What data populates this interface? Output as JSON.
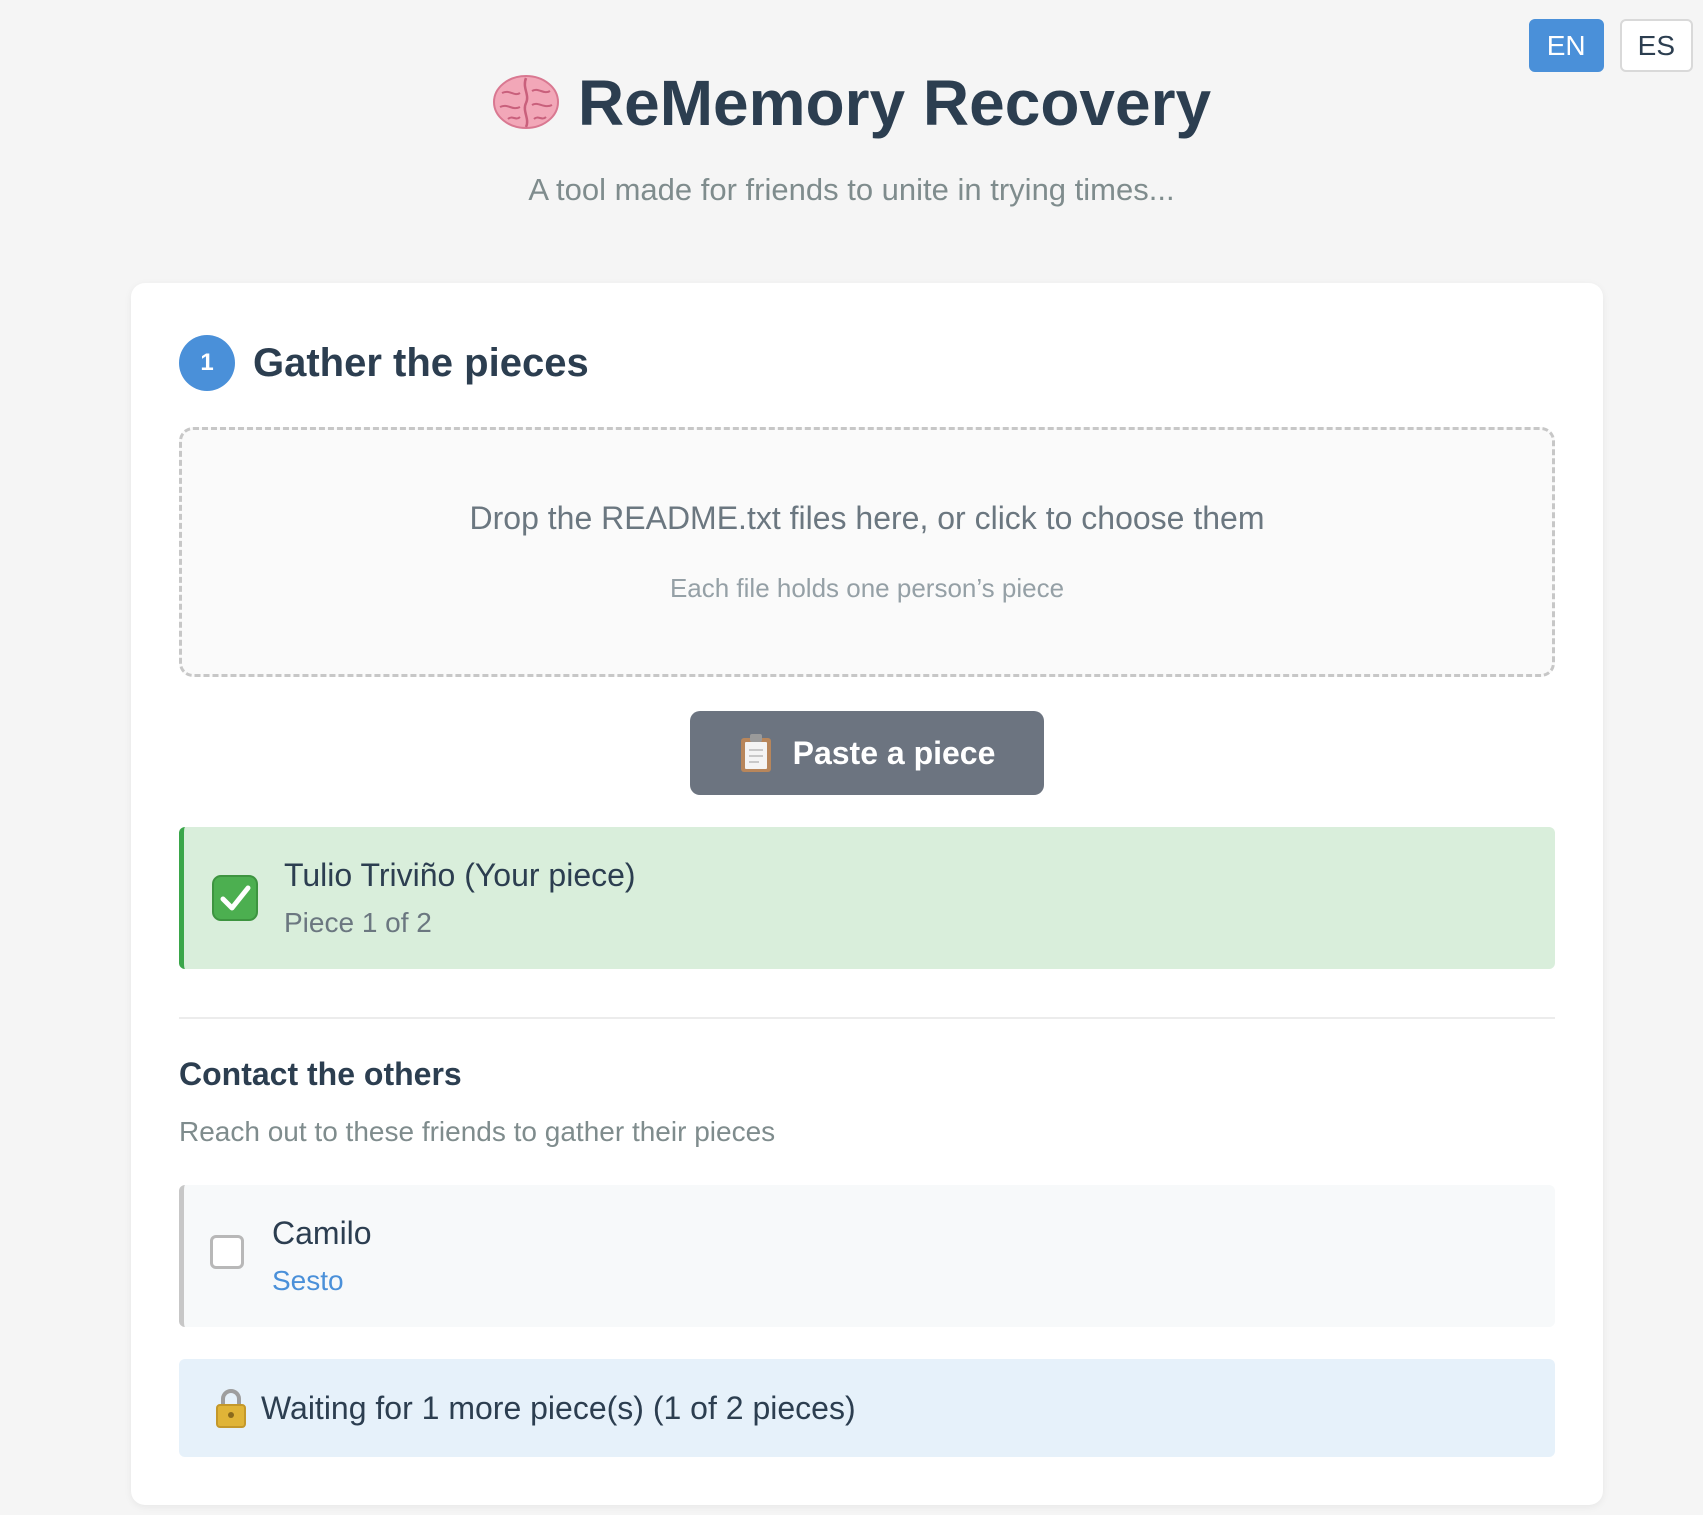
{
  "header": {
    "title": "ReMemory Recovery",
    "subtitle": "A tool made for friends to unite in trying times...",
    "title_icon": "brain-icon"
  },
  "language": {
    "options": [
      {
        "label": "EN",
        "active": true
      },
      {
        "label": "ES",
        "active": false
      }
    ]
  },
  "step": {
    "number": "1",
    "title": "Gather the pieces"
  },
  "dropzone": {
    "main_text": "Drop the README.txt files here, or click to choose them",
    "sub_text": "Each file holds one person’s piece"
  },
  "paste_button": {
    "label": "Paste a piece",
    "icon": "clipboard-icon"
  },
  "pieces": [
    {
      "name": "Tulio Triviño (Your piece)",
      "meta": "Piece 1 of 2",
      "icon": "check-icon"
    }
  ],
  "contacts": {
    "title": "Contact the others",
    "description": "Reach out to these friends to gather their pieces",
    "items": [
      {
        "name": "Camilo",
        "link": "Sesto",
        "checked": false
      }
    ]
  },
  "status": {
    "text": "Waiting for 1 more piece(s) (1 of 2 pieces)",
    "icon": "lock-icon"
  },
  "colors": {
    "accent": "#4a90d9",
    "success_bg": "#d9eedb",
    "success_border": "#3aa64a",
    "info_bg": "#e6f1fa",
    "button_bg": "#6c7480"
  }
}
